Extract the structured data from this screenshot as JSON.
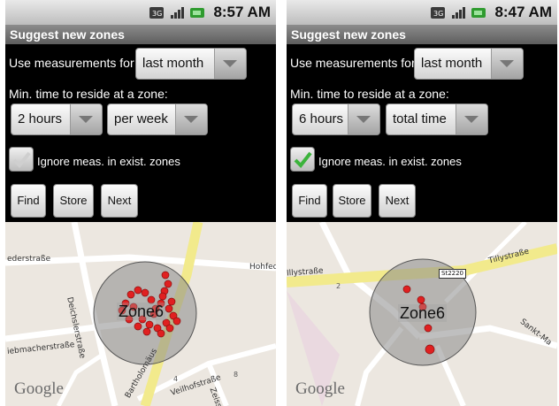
{
  "screens": [
    {
      "clock": "8:57 AM",
      "title": "Suggest new zones",
      "measurements_label": "Use measurements for",
      "measurements_value": "last month",
      "min_time_label": "Min. time to reside at a zone:",
      "duration_value": "2 hours",
      "period_value": "per week",
      "ignore_label": "Ignore meas. in exist. zones",
      "ignore_checked": false,
      "buttons": {
        "find": "Find",
        "store": "Store",
        "next": "Next"
      },
      "map": {
        "zone_label": "Zone6",
        "google_logo": "Google",
        "streets": {
          "s1": "ederstraße",
          "s2": "Deichslerstraße",
          "s3": "Hohfed",
          "s4": "iebmacherstraße",
          "s5": "Bartholomäus",
          "s6": "Veilhofstraße",
          "s7": "Zeiss"
        },
        "house_numbers": [
          "4",
          "8"
        ]
      }
    },
    {
      "clock": "8:47 AM",
      "title": "Suggest new zones",
      "measurements_label": "Use measurements for",
      "measurements_value": "last month",
      "min_time_label": "Min. time to reside at a zone:",
      "duration_value": "6 hours",
      "period_value": "total time",
      "ignore_label": "Ignore meas. in exist. zones",
      "ignore_checked": true,
      "buttons": {
        "find": "Find",
        "store": "Store",
        "next": "Next"
      },
      "map": {
        "zone_label": "Zone6",
        "google_logo": "Google",
        "streets": {
          "s1": "Illystraße",
          "s2": "Tillystraße",
          "s3": "Sankt-Ma"
        },
        "route_shield": "St2220",
        "house_numbers": [
          "2"
        ]
      }
    }
  ],
  "colors": {
    "zone_circle": "#8a8a8a",
    "measurement_dot": "#e02020",
    "check_green": "#3bb33b",
    "highlight_road": "#f2ea8c"
  }
}
